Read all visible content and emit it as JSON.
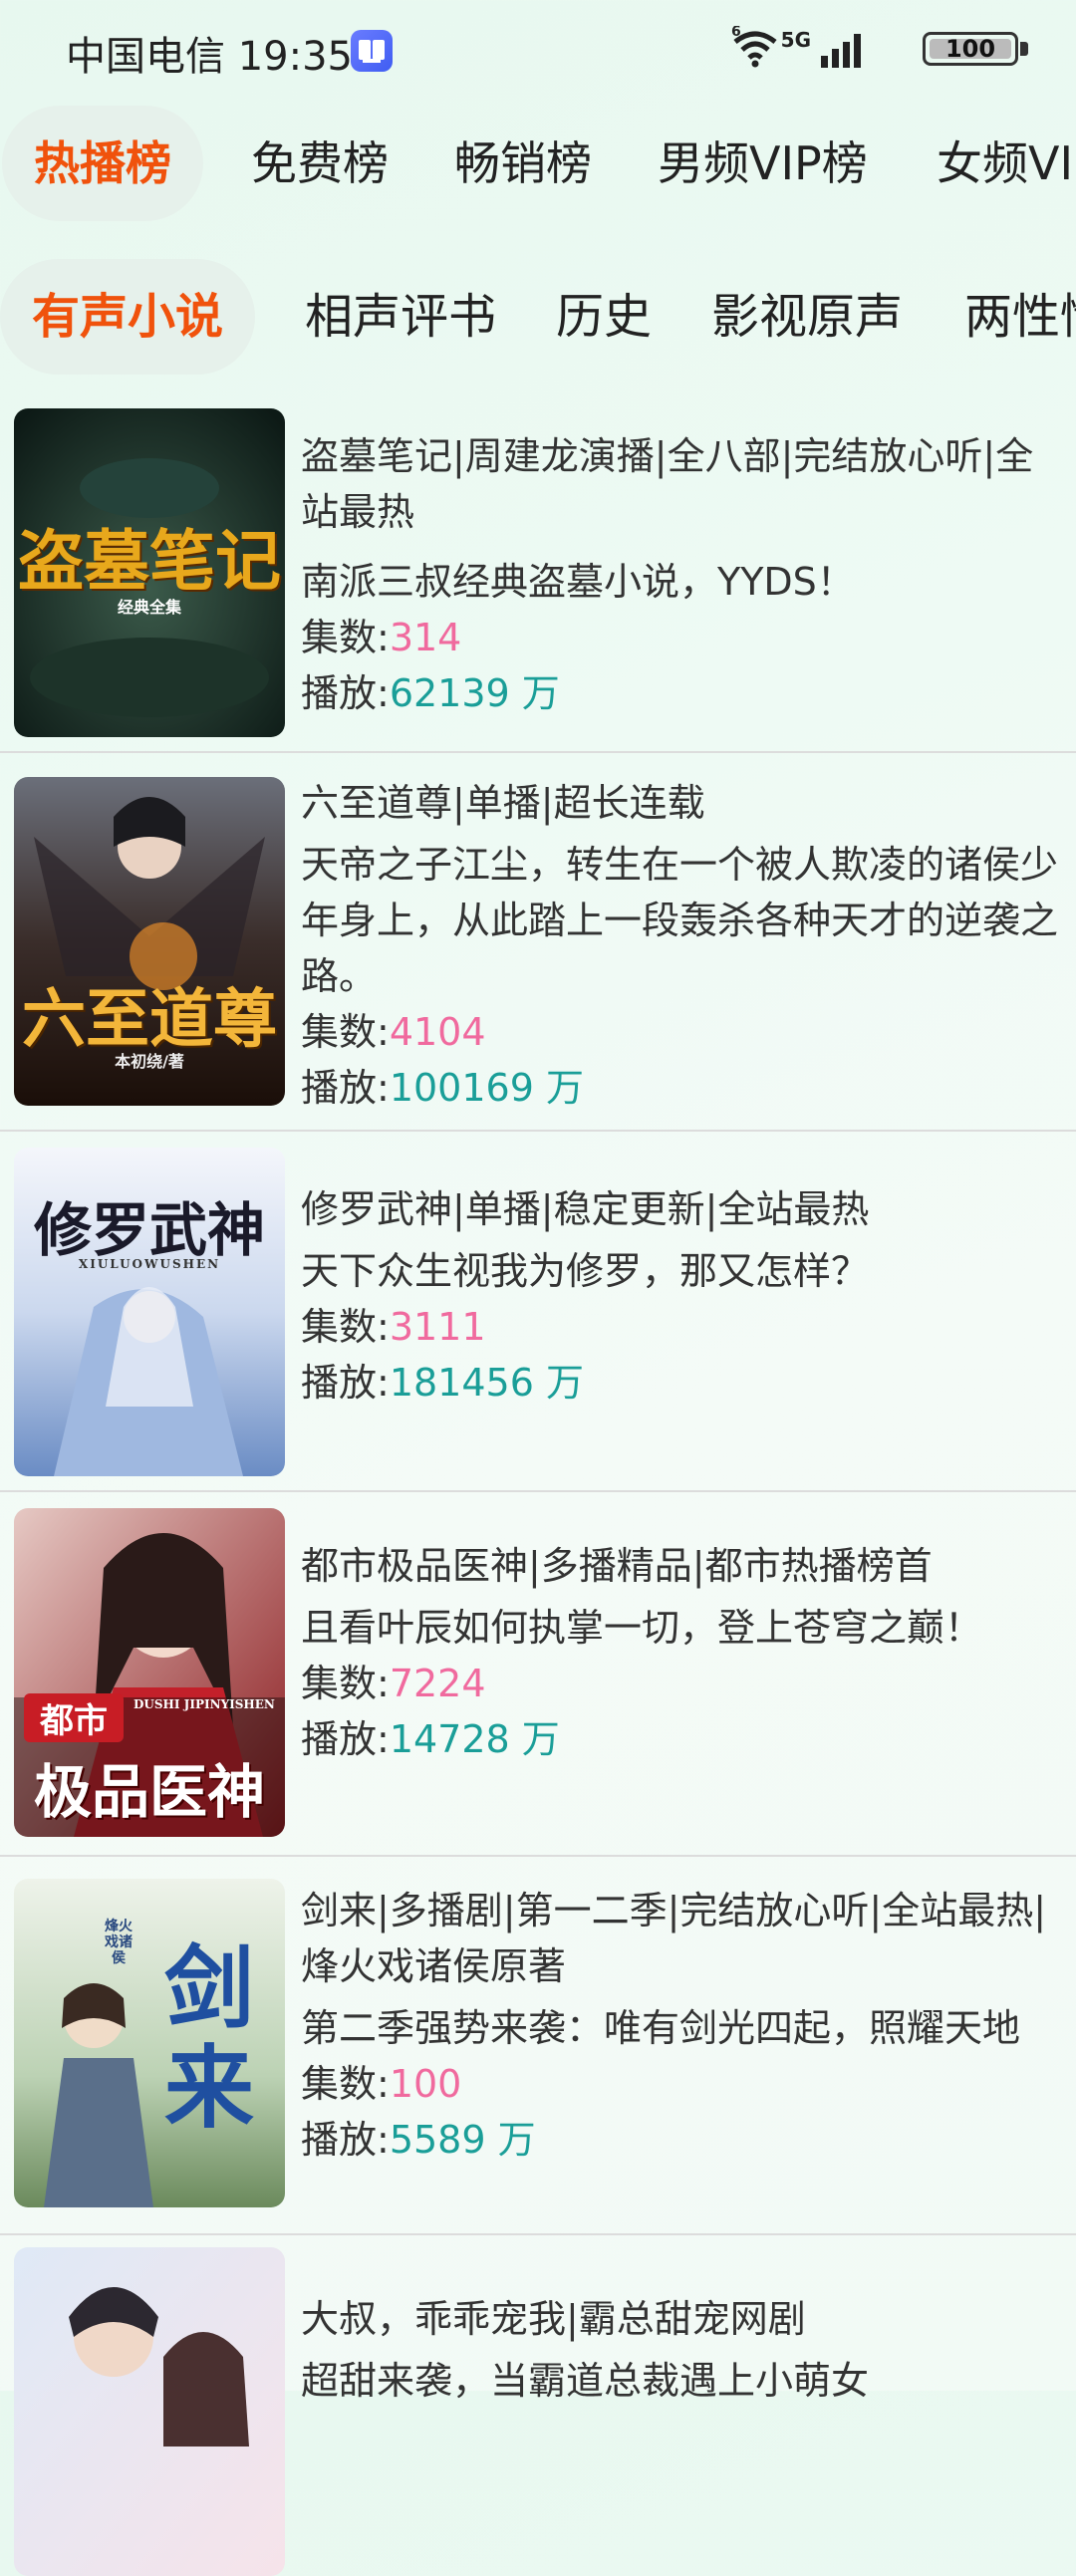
{
  "status": {
    "carrier_time": "中国电信 19:35",
    "wifi_badge": "6",
    "network": "5G",
    "battery": "100"
  },
  "tabs_primary": [
    "热播榜",
    "免费榜",
    "畅销榜",
    "男频VIP榜",
    "女频VIP榜"
  ],
  "tabs_secondary": [
    "有声小说",
    "相声评书",
    "历史",
    "影视原声",
    "两性情感"
  ],
  "labels": {
    "episodes": "集数:",
    "plays": "播放:",
    "plays_unit": " 万"
  },
  "books": [
    {
      "title": "盗墓笔记|周建龙演播|全八部|完结放心听|全站最热",
      "desc": "南派三叔经典盗墓小说，YYDS！",
      "episodes": "314",
      "plays": "62139",
      "cover_title": "盗墓笔记",
      "cover_sub": "经典全集"
    },
    {
      "title": "六至道尊|单播|超长连载",
      "desc": "天帝之子江尘，转生在一个被人欺凌的诸侯少年身上，从此踏上一段轰杀各种天才的逆袭之路。",
      "episodes": "4104",
      "plays": "100169",
      "cover_title": "六至道尊",
      "cover_sub": "本初绕/著"
    },
    {
      "title": "修罗武神|单播|稳定更新|全站最热",
      "desc": "天下众生视我为修罗，那又怎样？",
      "episodes": "3111",
      "plays": "181456",
      "cover_title": "修罗武神",
      "cover_sub": "XIULUOWUSHEN"
    },
    {
      "title": "都市极品医神|多播精品|都市热播榜首",
      "desc": "且看叶辰如何执掌一切，登上苍穹之巅！",
      "episodes": "7224",
      "plays": "14728",
      "cover_title": "极品医神",
      "cover_sub": "DUSHI JIPINYISHEN",
      "cover_tag": "都市"
    },
    {
      "title": "剑来|多播剧|第一二季|完结放心听|全站最热|烽火戏诸侯原著",
      "desc": "第二季强势来袭：唯有剑光四起，照耀天地",
      "episodes": "100",
      "plays": "5589",
      "cover_title": "剑来",
      "cover_sub": "烽火戏诸侯"
    },
    {
      "title": "大叔，乖乖宠我|霸总甜宠网剧",
      "desc": "超甜来袭，当霸道总裁遇上小萌女",
      "episodes": "",
      "plays": ""
    }
  ]
}
